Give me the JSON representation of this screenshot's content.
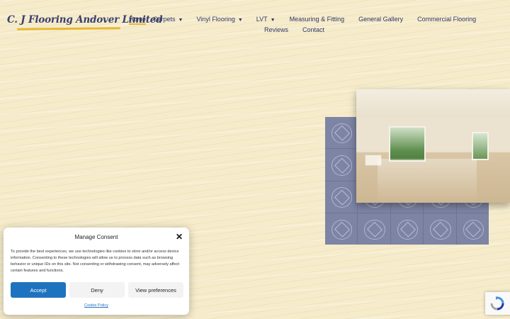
{
  "logo": {
    "text": "C. J Flooring Andover Limited"
  },
  "nav": {
    "row1": [
      {
        "label": "Home",
        "caret": false,
        "active": true
      },
      {
        "label": "Carpets",
        "caret": true
      },
      {
        "label": "Vinyl Flooring",
        "caret": true
      },
      {
        "label": "LVT",
        "caret": true
      },
      {
        "label": "Measuring & Fitting",
        "caret": false
      },
      {
        "label": "General Gallery",
        "caret": false
      },
      {
        "label": "Commercial Flooring",
        "caret": false
      }
    ],
    "row2": [
      {
        "label": "Reviews"
      },
      {
        "label": "Contact"
      }
    ],
    "caret_glyph": "▼",
    "accent_color": "#e6b830"
  },
  "consent": {
    "title": "Manage Consent",
    "close_glyph": "✕",
    "body": "To provide the best experiences, we use technologies like cookies to store and/or access device information. Consenting to these technologies will allow us to process data such as browsing behavior or unique IDs on this site. Not consenting or withdrawing consent, may adversely affect certain features and functions.",
    "accept_label": "Accept",
    "deny_label": "Deny",
    "preferences_label": "View preferences",
    "policy_link": "Cookie Policy",
    "accent_color": "#1e73be"
  },
  "icons": {
    "recaptcha": "recaptcha-icon",
    "close": "close-icon",
    "dropdown": "chevron-down-icon"
  }
}
